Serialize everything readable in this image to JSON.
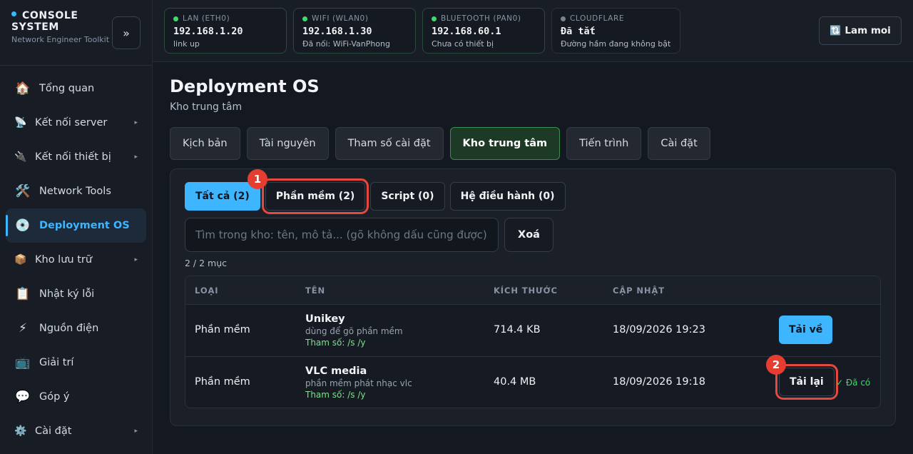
{
  "brand": {
    "title": "CONSOLE SYSTEM",
    "subtitle": "Network Engineer Toolkit"
  },
  "sidebar": {
    "collapse_label": "»",
    "items": [
      {
        "label": "Tổng quan",
        "icon": "🏠"
      },
      {
        "label": "Kết nối server",
        "icon": "📡",
        "chevron": "▸"
      },
      {
        "label": "Kết nối thiết bị",
        "icon": "🔌",
        "chevron": "▸"
      },
      {
        "label": "Network Tools",
        "icon": "🛠️"
      },
      {
        "label": "Deployment OS",
        "icon": "💿"
      },
      {
        "label": "Kho lưu trữ",
        "icon": "📦",
        "chevron": "▸"
      },
      {
        "label": "Nhật ký lỗi",
        "icon": "📋"
      },
      {
        "label": "Nguồn điện",
        "icon": "⚡"
      },
      {
        "label": "Giải trí",
        "icon": "📺"
      },
      {
        "label": "Góp ý",
        "icon": "💬"
      },
      {
        "label": "Cài đặt",
        "icon": "⚙️",
        "chevron": "▸"
      }
    ]
  },
  "network": [
    {
      "label": "LAN (ETH0)",
      "ip": "192.168.1.20",
      "status": "link up"
    },
    {
      "label": "WIFI (WLAN0)",
      "ip": "192.168.1.30",
      "status": "Đã nối: WiFi-VanPhong"
    },
    {
      "label": "BLUETOOTH (PAN0)",
      "ip": "192.168.60.1",
      "status": "Chưa có thiết bị"
    },
    {
      "label": "CLOUDFLARE",
      "ip": "Đã tắt",
      "status": "Đường hầm đang không bật"
    }
  ],
  "refresh": {
    "icon": "🔃",
    "label": "Lam moi"
  },
  "page": {
    "title": "Deployment OS",
    "subtitle": "Kho trung tâm"
  },
  "tabs": [
    "Kịch bản",
    "Tài nguyên",
    "Tham số cài đặt",
    "Kho trung tâm",
    "Tiến trình",
    "Cài đặt"
  ],
  "filters": [
    "Tất cả (2)",
    "Phần mềm (2)",
    "Script (0)",
    "Hệ điều hành (0)"
  ],
  "search": {
    "placeholder": "Tìm trong kho: tên, mô tả... (gõ không dấu cũng được)",
    "clear_label": "Xoá"
  },
  "count": "2 / 2 mục",
  "table": {
    "headers": [
      "LOẠI",
      "TÊN",
      "KÍCH THƯỚC",
      "CẬP NHẬT"
    ],
    "rows": [
      {
        "type": "Phần mềm",
        "name": "Unikey",
        "desc": "dùng để gõ phần mềm",
        "param": "Tham số: /s /y",
        "size": "714.4 KB",
        "date": "18/09/2026 19:23",
        "action": "Tải về"
      },
      {
        "type": "Phần mềm",
        "name": "VLC media",
        "desc": "phần mềm phát nhạc vlc",
        "param": "Tham số: /s /y",
        "size": "40.4 MB",
        "date": "18/09/2026 19:18",
        "action": "Tải lại",
        "status": "✓ Đã có"
      }
    ]
  },
  "annotations": [
    "1",
    "2"
  ]
}
